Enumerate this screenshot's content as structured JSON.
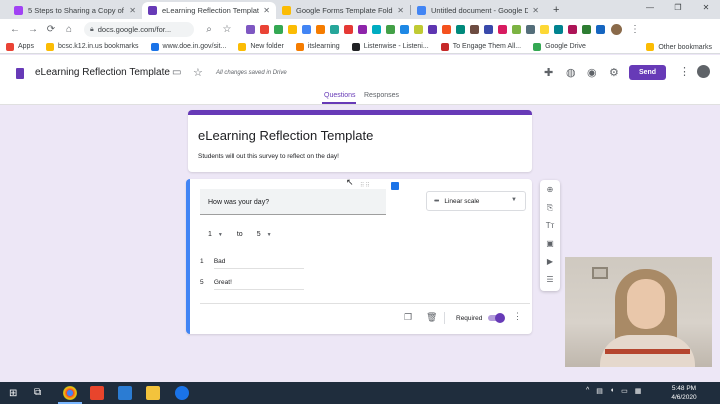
{
  "browser": {
    "tabs": [
      {
        "title": "5 Steps to Sharing a Copy of a G",
        "active": false,
        "favicon_color": "#a142f4"
      },
      {
        "title": "eLearning Reflection Template",
        "active": true,
        "favicon_color": "#673ab7"
      },
      {
        "title": "Google Forms Template Folder",
        "active": false,
        "favicon_color": "#fbbc04"
      },
      {
        "title": "Untitled document - Google Doc",
        "active": false,
        "favicon_color": "#4285f4"
      }
    ],
    "url": "docs.google.com/for...",
    "bookmarks": [
      {
        "label": "Apps",
        "icon_color": "#ea4335"
      },
      {
        "label": "bcsc.k12.in.us bookmarks",
        "icon_color": "#fbbc04"
      },
      {
        "label": "www.doe.in.gov/sit...",
        "icon_color": "#1a73e8"
      },
      {
        "label": "New folder",
        "icon_color": "#fbbc04"
      },
      {
        "label": "itslearning",
        "icon_color": "#f57c00"
      },
      {
        "label": "Listenwise - Listeni...",
        "icon_color": "#202124"
      },
      {
        "label": "To Engage Them All...",
        "icon_color": "#c62828"
      },
      {
        "label": "Google Drive",
        "icon_color": "#34a853"
      }
    ],
    "other_bookmarks": "Other bookmarks"
  },
  "header": {
    "form_title": "eLearning Reflection Template",
    "save_status": "All changes saved in Drive",
    "send_label": "Send",
    "brand_color": "#673ab7"
  },
  "form_tabs": {
    "questions": "Questions",
    "responses": "Responses"
  },
  "title_card": {
    "title": "eLearning Reflection Template",
    "description": "Students will out this survey to reflect on the day!"
  },
  "question": {
    "text": "How was your day?",
    "type": "Linear scale",
    "scale_min": "1",
    "scale_to": "to",
    "scale_max": "5",
    "label_min_num": "1",
    "label_min": "Bad",
    "label_max_num": "5",
    "label_max": "Great!",
    "required_label": "Required",
    "required": true
  },
  "taskbar": {
    "time": "5:48 PM",
    "date": "4/6/2020"
  }
}
